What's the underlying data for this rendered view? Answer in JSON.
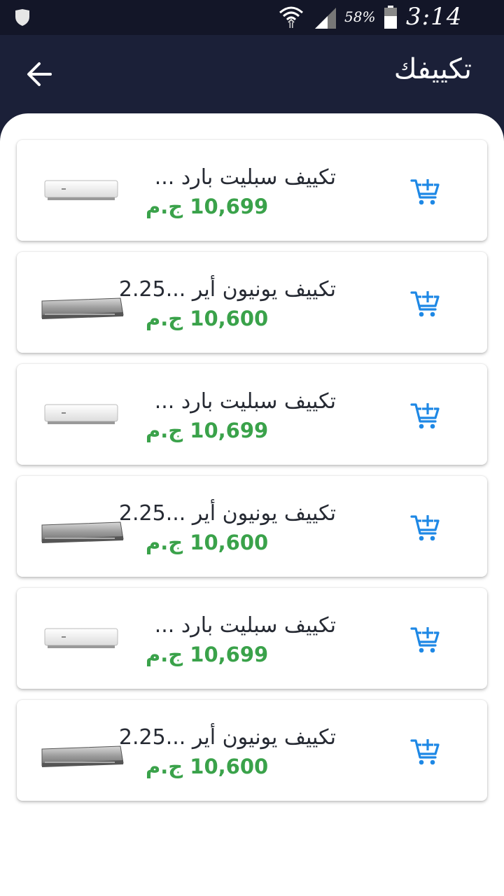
{
  "status_bar": {
    "battery_percent": "58%",
    "time": "3:14 AM"
  },
  "app_bar": {
    "title": "تكييفك",
    "back_icon": "arrow-left-icon"
  },
  "products": [
    {
      "name": "تكييف سبليت بارد ...",
      "price": "10,699 ج.م",
      "image_type": "white-split-ac",
      "cart_icon": "add-to-cart-icon"
    },
    {
      "name": "تكييف يونيون أير ...2.25",
      "price": "10,600 ج.م",
      "image_type": "silver-split-ac",
      "cart_icon": "add-to-cart-icon"
    },
    {
      "name": "تكييف سبليت بارد ...",
      "price": "10,699 ج.م",
      "image_type": "white-split-ac",
      "cart_icon": "add-to-cart-icon"
    },
    {
      "name": "تكييف يونيون أير ...2.25",
      "price": "10,600 ج.م",
      "image_type": "silver-split-ac",
      "cart_icon": "add-to-cart-icon"
    },
    {
      "name": "تكييف سبليت بارد ...",
      "price": "10,699 ج.م",
      "image_type": "white-split-ac",
      "cart_icon": "add-to-cart-icon"
    },
    {
      "name": "تكييف يونيون أير ...2.25",
      "price": "10,600 ج.م",
      "image_type": "silver-split-ac",
      "cart_icon": "add-to-cart-icon"
    }
  ],
  "colors": {
    "app_bar": "#1b2038",
    "price": "#3aa24a",
    "cart_icon": "#1e88e5"
  }
}
